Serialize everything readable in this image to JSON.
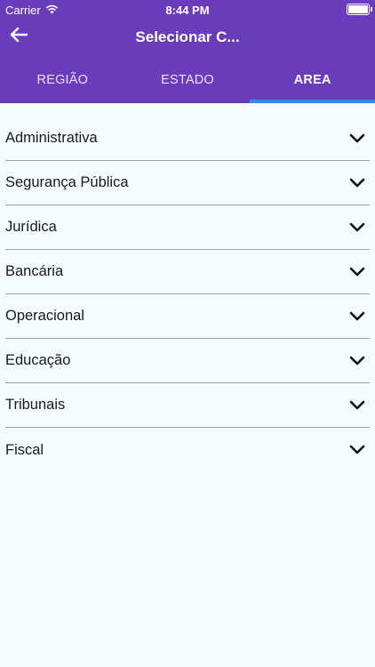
{
  "status": {
    "carrier": "Carrier",
    "time": "8:44 PM"
  },
  "nav": {
    "title": "Selecionar C..."
  },
  "tabs": [
    {
      "label": "REGIÃO",
      "active": false
    },
    {
      "label": "ESTADO",
      "active": false
    },
    {
      "label": "AREA",
      "active": true
    }
  ],
  "areas": [
    {
      "label": "Administrativa"
    },
    {
      "label": "Segurança Pública"
    },
    {
      "label": "Jurídica"
    },
    {
      "label": "Bancária"
    },
    {
      "label": "Operacional"
    },
    {
      "label": "Educação"
    },
    {
      "label": "Tribunais"
    },
    {
      "label": "Fiscal"
    }
  ],
  "colors": {
    "header": "#6a3cbc",
    "tab_indicator": "#2f8bf2",
    "background": "#f4fbfe"
  },
  "icons": {
    "back": "arrow-left-icon",
    "expand": "chevron-down-icon",
    "wifi": "wifi-icon",
    "battery": "battery-icon"
  }
}
